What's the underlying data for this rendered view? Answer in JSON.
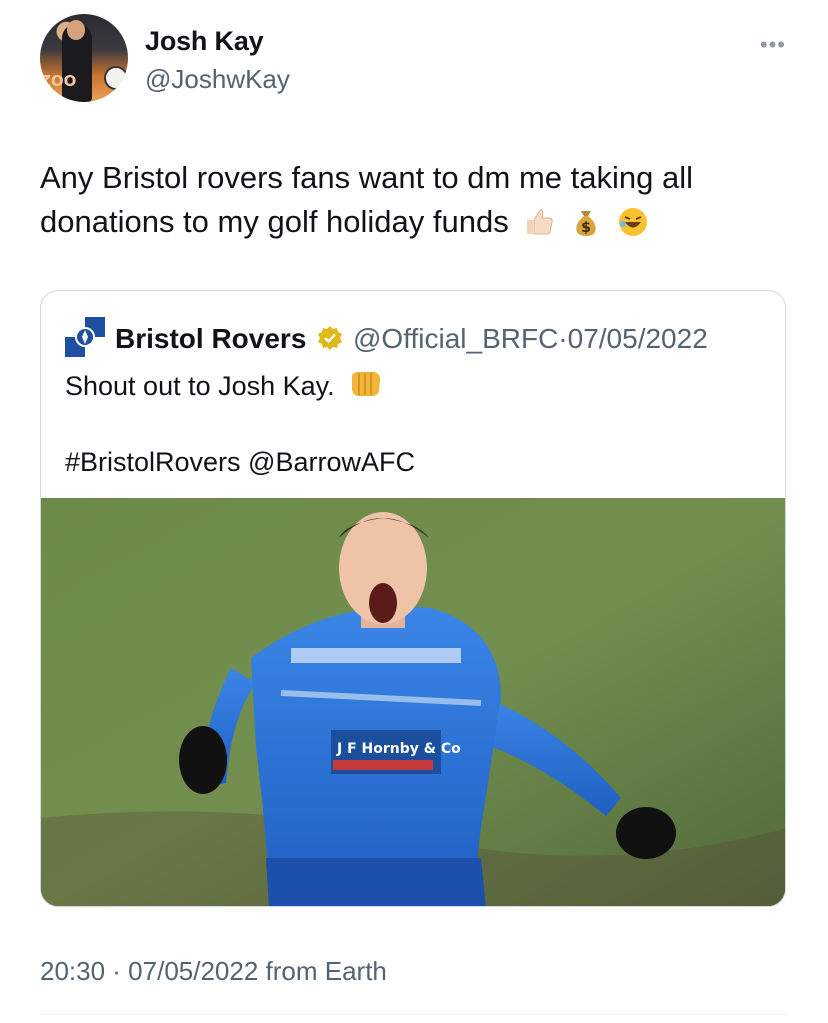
{
  "author": {
    "name": "Josh Kay",
    "handle": "@JoshwKay",
    "avatar_text": "ZOO"
  },
  "tweet": {
    "text": "Any Bristol rovers fans want to dm me taking all donations to my golf holiday funds",
    "emojis": [
      "thumbs-up-light-skin",
      "money-bag",
      "rolling-on-floor-laughing"
    ]
  },
  "quoted": {
    "name": "Bristol Rovers",
    "verified": true,
    "handle": "@Official_BRFC",
    "separator": "·",
    "date": "07/05/2022",
    "text": "Shout out to Josh Kay.",
    "text_emoji": "oncoming-fist",
    "hashtags": "#BristolRovers @BarrowAFC",
    "photo": {
      "kit_sponsor": "J F Hornby & Co"
    }
  },
  "footer": {
    "timestamp": "20:30 · 07/05/2022 from Earth"
  },
  "colors": {
    "text_primary": "#0f1419",
    "text_secondary": "#536471",
    "border": "#cfd9de",
    "verified_gold": "#e2b719",
    "kit_blue": "#2f73d6"
  },
  "icons": {
    "more": "more-dots-icon",
    "verified": "verified-badge-icon"
  }
}
